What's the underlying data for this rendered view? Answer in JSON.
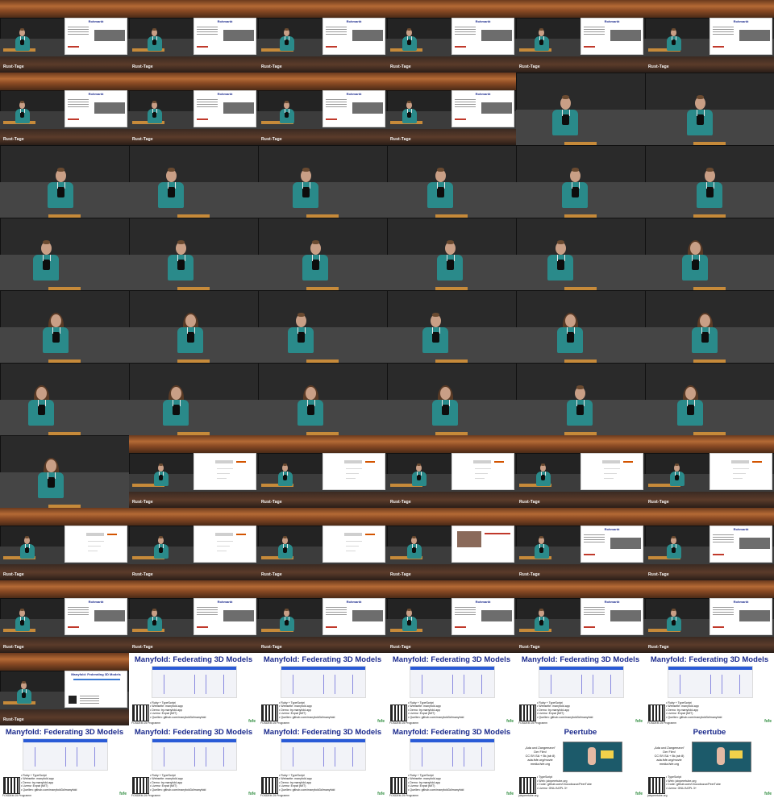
{
  "grid": {
    "columns": 6,
    "rows": 11,
    "tile_count": 66
  },
  "brand_logo_text": "Rust-Tage",
  "slides": {
    "rohmarkt": {
      "title": "Rohmarkt"
    },
    "manyfold": {
      "title": "Manyfold: Federating 3D Models",
      "bullets": [
        "Ruby + TypeScript",
        "Webseite: manyfold.app",
        "Demo: try.manyfold.app",
        "Lizenz: Expat (MIT)",
        "Quellen: github.com/manyfold3d/manyfold"
      ],
      "footer": "FOSDEM 25 Programm\ninkl. Video + Folien"
    },
    "peertube": {
      "title": "Peertube",
      "text": [
        "„Ada und Zangemann\"",
        "Der Film!",
        "CC BY-SA + 5k (ab 8)",
        "ada.fsfe.org/movie",
        "media.fsfe.org"
      ],
      "bullets": [
        "TypeScript",
        "Web: joinpeertube.org",
        "Code: github.com/Chocobozzz/PeerTube",
        "Lizenz: GNU AGPL 3+"
      ],
      "footer": "joinpeertube.org"
    },
    "footer_logo": "fsfe"
  },
  "tiles": [
    "room-with-rohmarkt-slide",
    "room-with-rohmarkt-slide",
    "room-with-rohmarkt-slide",
    "room-with-rohmarkt-slide",
    "room-with-rohmarkt-slide",
    "room-with-rohmarkt-slide",
    "room-with-rohmarkt-slide",
    "room-with-rohmarkt-slide",
    "room-with-rohmarkt-slide",
    "room-with-rohmarkt-slide",
    "speaker-closeup",
    "speaker-closeup",
    "speaker-closeup",
    "speaker-closeup",
    "speaker-closeup",
    "speaker-closeup",
    "speaker-closeup",
    "speaker-closeup",
    "speaker-closeup",
    "speaker-closeup",
    "speaker-closeup",
    "speaker-closeup",
    "speaker-closeup",
    "speaker2-closeup",
    "speaker2-closeup",
    "speaker2-closeup",
    "speaker-closeup",
    "speaker-closeup",
    "speaker2-closeup",
    "speaker2-closeup",
    "speaker2-closeup",
    "speaker2-closeup",
    "speaker2-closeup",
    "speaker2-closeup",
    "speaker-closeup",
    "speaker2-closeup",
    "speaker2-closeup",
    "room-with-blank-slide",
    "room-with-blank-slide",
    "room-with-blank-slide",
    "room-with-blank-slide",
    "room-with-blank-slide",
    "room-with-blank-slide",
    "room-with-blank-slide",
    "room-with-blank-slide",
    "room-with-photo-slide",
    "room-with-rohmarkt-slide",
    "room-with-rohmarkt-slide",
    "room-with-rohmarkt-slide",
    "room-with-rohmarkt-slide",
    "room-with-rohmarkt-slide",
    "room-with-rohmarkt-slide",
    "room-with-rohmarkt-slide",
    "room-with-rohmarkt-slide",
    "room-with-manyfold-slide",
    "manyfold-slide",
    "manyfold-slide",
    "manyfold-slide",
    "manyfold-slide",
    "manyfold-slide",
    "manyfold-slide",
    "manyfold-slide",
    "manyfold-slide",
    "manyfold-slide",
    "peertube-slide",
    "peertube-slide"
  ]
}
